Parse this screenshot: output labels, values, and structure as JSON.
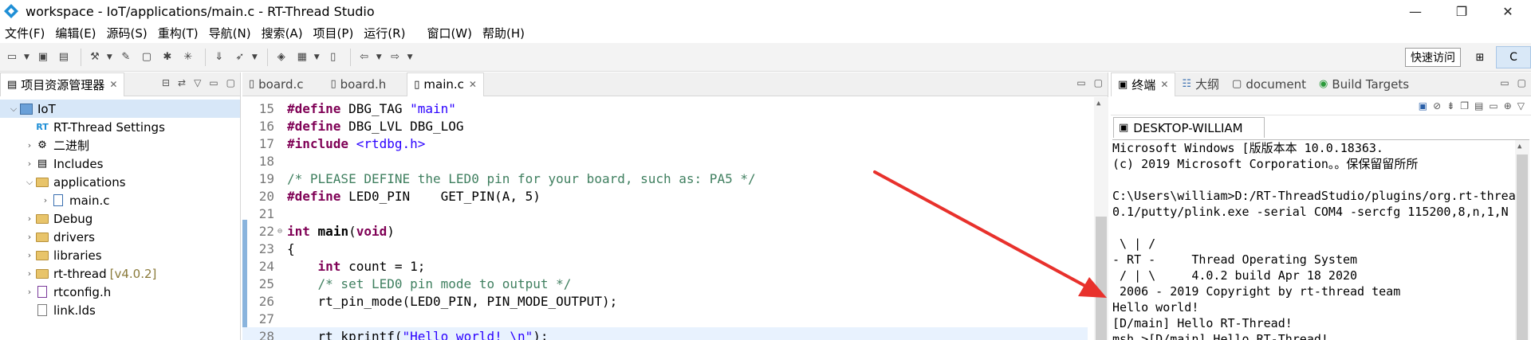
{
  "window": {
    "title": "workspace - IoT/applications/main.c - RT-Thread Studio",
    "controls": {
      "minimize": "—",
      "maximize": "❐",
      "close": "✕"
    }
  },
  "menu": [
    "文件(F)",
    "编辑(E)",
    "源码(S)",
    "重构(T)",
    "导航(N)",
    "搜索(A)",
    "项目(P)",
    "运行(R)",
    "窗口(W)",
    "帮助(H)"
  ],
  "toolbar": {
    "quick_access": "快速访问",
    "perspective": "C"
  },
  "explorer": {
    "tab_label": "项目资源管理器",
    "tree": [
      {
        "label": "IoT",
        "level": 0,
        "twist": "⌵",
        "icon": "project-icon",
        "selected": true
      },
      {
        "label": "RT-Thread Settings",
        "level": 1,
        "twist": "",
        "icon": "settings-icon"
      },
      {
        "label": "二进制",
        "level": 1,
        "twist": "›",
        "icon": "binary-icon"
      },
      {
        "label": "Includes",
        "level": 1,
        "twist": "›",
        "icon": "includes-icon"
      },
      {
        "label": "applications",
        "level": 1,
        "twist": "⌵",
        "icon": "folder-icon"
      },
      {
        "label": "main.c",
        "level": 2,
        "twist": "›",
        "icon": "c-file-icon"
      },
      {
        "label": "Debug",
        "level": 1,
        "twist": "›",
        "icon": "folder-icon"
      },
      {
        "label": "drivers",
        "level": 1,
        "twist": "›",
        "icon": "folder-icon"
      },
      {
        "label": "libraries",
        "level": 1,
        "twist": "›",
        "icon": "folder-icon"
      },
      {
        "label": "rt-thread",
        "version": "[v4.0.2]",
        "level": 1,
        "twist": "›",
        "icon": "folder-icon"
      },
      {
        "label": "rtconfig.h",
        "level": 1,
        "twist": "›",
        "icon": "h-file-icon"
      },
      {
        "label": "link.lds",
        "level": 1,
        "twist": "",
        "icon": "file-icon"
      }
    ]
  },
  "editor": {
    "tabs": [
      {
        "label": "board.c",
        "active": false
      },
      {
        "label": "board.h",
        "active": false
      },
      {
        "label": "main.c",
        "active": true
      }
    ],
    "lines": [
      {
        "n": "15",
        "parts": [
          [
            "kw",
            "#define"
          ],
          [
            "",
            " DBG_TAG "
          ],
          [
            "str",
            "\"main\""
          ]
        ]
      },
      {
        "n": "16",
        "parts": [
          [
            "kw",
            "#define"
          ],
          [
            "",
            " DBG_LVL DBG_LOG"
          ]
        ]
      },
      {
        "n": "17",
        "parts": [
          [
            "kw",
            "#include"
          ],
          [
            "",
            " "
          ],
          [
            "inc",
            "<rtdbg.h>"
          ]
        ]
      },
      {
        "n": "18",
        "parts": []
      },
      {
        "n": "19",
        "parts": [
          [
            "cmt",
            "/* PLEASE DEFINE the LED0 pin for your board, such as: PA5 */"
          ]
        ]
      },
      {
        "n": "20",
        "parts": [
          [
            "kw",
            "#define"
          ],
          [
            "",
            " LED0_PIN    GET_PIN(A, 5)"
          ]
        ]
      },
      {
        "n": "21",
        "parts": []
      },
      {
        "n": "22",
        "fold": "⊖",
        "parts": [
          [
            "kw",
            "int"
          ],
          [
            "",
            " "
          ],
          [
            "b",
            "main"
          ],
          [
            "",
            "("
          ],
          [
            "kw",
            "void"
          ],
          [
            "",
            ")"
          ]
        ]
      },
      {
        "n": "23",
        "parts": [
          [
            "",
            "{"
          ]
        ]
      },
      {
        "n": "24",
        "parts": [
          [
            "",
            "    "
          ],
          [
            "kw",
            "int"
          ],
          [
            "",
            " count = 1;"
          ]
        ]
      },
      {
        "n": "25",
        "parts": [
          [
            "",
            "    "
          ],
          [
            "cmt",
            "/* set LED0 pin mode to output */"
          ]
        ]
      },
      {
        "n": "26",
        "parts": [
          [
            "",
            "    rt_pin_mode(LED0_PIN, PIN_MODE_OUTPUT);"
          ]
        ]
      },
      {
        "n": "27",
        "parts": []
      },
      {
        "n": "28",
        "hl": true,
        "parts": [
          [
            "",
            "    rt_kprintf("
          ],
          [
            "str",
            "\"Hello world! \\n\""
          ],
          [
            "",
            ");"
          ]
        ]
      }
    ]
  },
  "terminal": {
    "tabs": [
      {
        "label": "终端",
        "active": true,
        "icon": "terminal-icon"
      },
      {
        "label": "大纲",
        "active": false,
        "icon": "outline-icon"
      },
      {
        "label": "document",
        "active": false,
        "icon": "document-icon"
      },
      {
        "label": "Build Targets",
        "active": false,
        "icon": "build-targets-icon"
      }
    ],
    "session": "DESKTOP-WILLIAM",
    "lines": [
      "Microsoft Windows [版版本本 10.0.18363.",
      "(c) 2019 Microsoft Corporation。。保保留留所所",
      "",
      "C:\\Users\\william>D:/RT-ThreadStudio/plugins/org.rt-threa",
      "0.1/putty/plink.exe -serial COM4 -sercfg 115200,8,n,1,N",
      "",
      " \\ | /",
      "- RT -     Thread Operating System",
      " / | \\     4.0.2 build Apr 18 2020",
      " 2006 - 2019 Copyright by rt-thread team",
      "Hello world!",
      "[D/main] Hello RT-Thread!",
      "msh >[D/main] Hello RT-Thread!"
    ]
  },
  "colors": {
    "annotation_arrow": "#e8312c",
    "keyword": "#7f0055",
    "string": "#2a00ff",
    "comment": "#3f7f5f"
  }
}
